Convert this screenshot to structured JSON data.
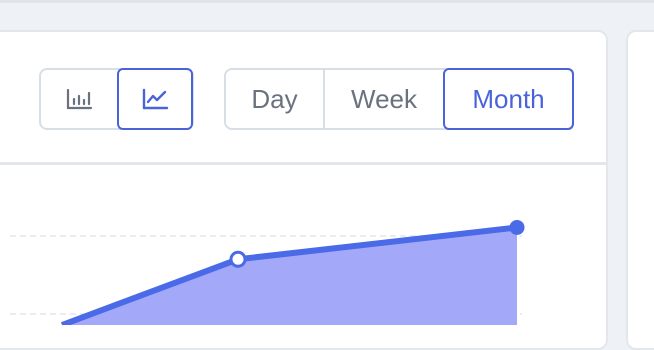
{
  "toolbar": {
    "chart_type_options": [
      {
        "icon": "bar-chart-icon",
        "selected": false
      },
      {
        "icon": "line-chart-icon",
        "selected": true
      }
    ],
    "range_options": [
      {
        "label": "Day",
        "selected": false
      },
      {
        "label": "Week",
        "selected": false
      },
      {
        "label": "Month",
        "selected": true
      }
    ]
  },
  "colors": {
    "accent": "#4a63d8",
    "line": "#4a6ae8",
    "area_fill": "#a3a8f8",
    "grid": "#e3e6ea"
  },
  "chart_data": {
    "type": "area",
    "series": [
      {
        "values": [
          0,
          0.62,
          0.92
        ]
      }
    ],
    "ylim": [
      0,
      1
    ],
    "grid": true
  }
}
